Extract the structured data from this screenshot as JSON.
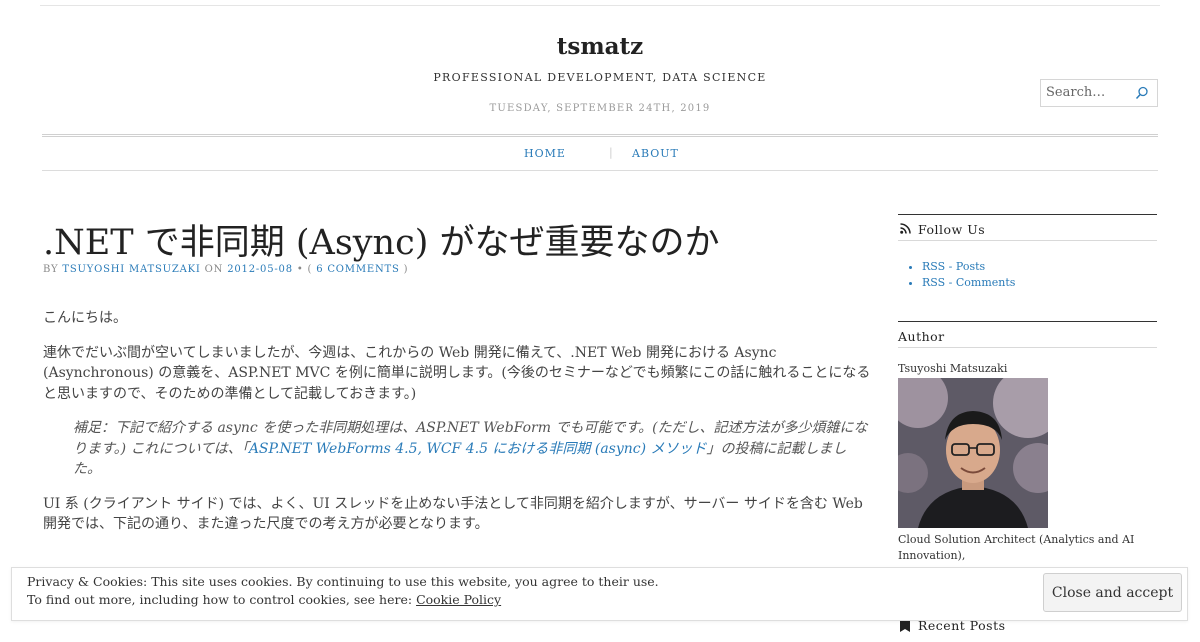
{
  "header": {
    "site_title": "tsmatz",
    "tagline": "PROFESSIONAL DEVELOPMENT, DATA SCIENCE",
    "date": "TUESDAY, SEPTEMBER 24TH, 2019"
  },
  "search": {
    "placeholder": "Search…",
    "icon": "search-icon"
  },
  "nav": {
    "home_label": "HOME",
    "about_label": "ABOUT",
    "separator": "|"
  },
  "post": {
    "title": ".NET で非同期 (Async) がなぜ重要なのか",
    "meta": {
      "by": "BY",
      "author": "TSUYOSHI MATSUZAKI",
      "on": "ON",
      "date": "2012-05-08",
      "bullet": "•",
      "open_paren": "(",
      "comments": "6 COMMENTS",
      "close_paren": ")"
    },
    "paragraphs": [
      "こんにちは。",
      "連休でだいぶ間が空いてしまいましたが、今週は、これからの Web 開発に備えて、.NET Web 開発における Async (Asynchronous) の意義を、ASP.NET MVC を例に簡単に説明します。(今後のセミナーなどでも頻繁にこの話に触れることになると思いますので、そのための準備として記載しておきます。)"
    ],
    "quote": {
      "before": "補足：下記で紹介する async を使った非同期処理は、ASP.NET WebForm でも可能です。(ただし、記述方法が多少煩雑になります。) これについては、「",
      "link": "ASP.NET WebForms 4.5, WCF 4.5 における非同期 (async) メソッド",
      "after": "」の投稿に記載しました。"
    },
    "paragraph_after_quote": "UI 系 (クライアント サイド) では、よく、UI スレッドを止めない手法として非同期を紹介しますが、サーバー サイドを含む Web 開発では、下記の通り、また違った尺度での考え方が必要となります。"
  },
  "sidebar": {
    "follow": {
      "title": "Follow Us",
      "icon": "rss-icon",
      "items": [
        "RSS - Posts",
        "RSS - Comments"
      ]
    },
    "author": {
      "title": "Author",
      "name": "Tsuyoshi Matsuzaki",
      "role": "Cloud Solution Architect (Analytics and AI Innovation),"
    },
    "recent": {
      "title": "Recent Posts",
      "icon": "recent-posts-icon"
    }
  },
  "cookie": {
    "line1": "Privacy & Cookies: This site uses cookies. By continuing to use this website, you agree to their use.",
    "line2_prefix": "To find out more, including how to control cookies, see here:",
    "policy_link": "Cookie Policy",
    "close_label": "Close and accept"
  },
  "colors": {
    "link": "#2a7bb8",
    "text": "#444444",
    "title": "#222222"
  }
}
